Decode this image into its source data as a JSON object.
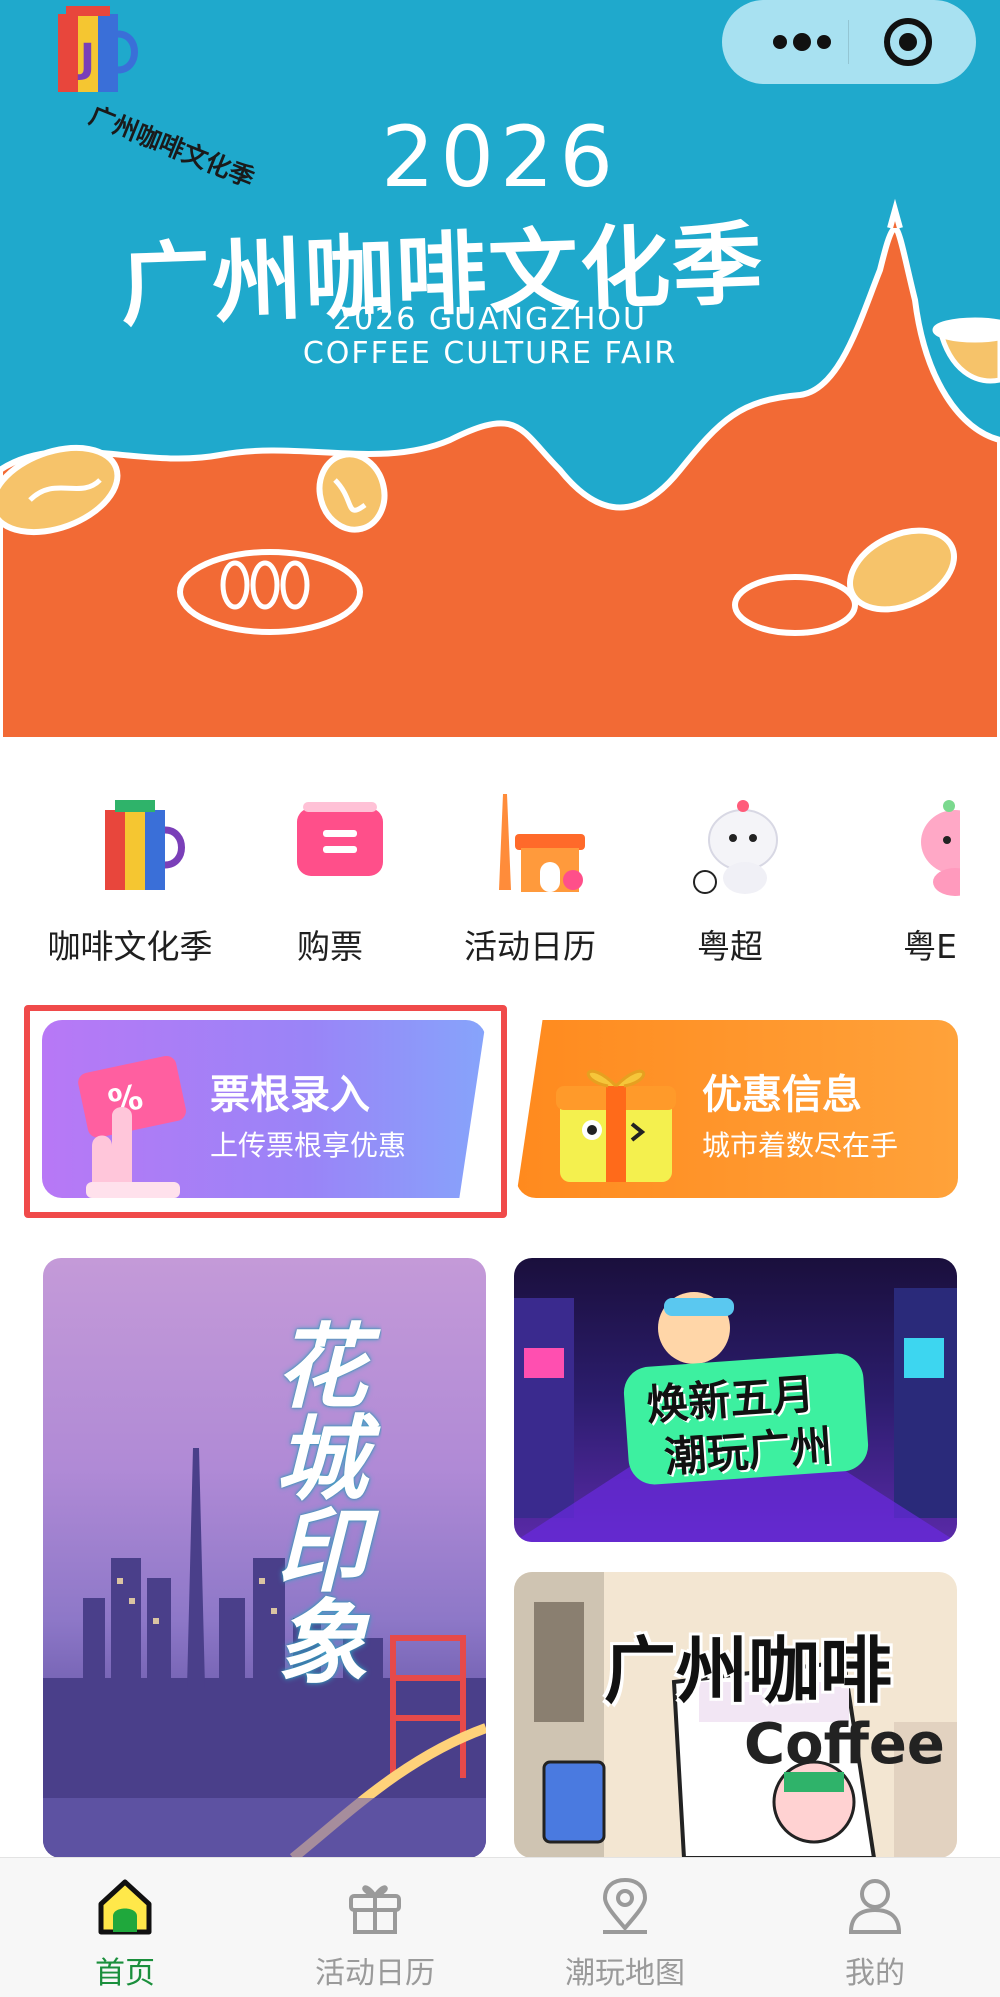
{
  "hero": {
    "year": "2026",
    "title": "广州咖啡文化季",
    "subtitle_en_line1": "2026 GUANGZHOU",
    "subtitle_en_line2": "COFFEE CULTURE FAIR",
    "logo_text": "广州咖啡文化季",
    "colors": {
      "sky": "#1fa9cc",
      "ground": "#f26a35",
      "bean": "#f6c36a"
    }
  },
  "capsule": {
    "more_icon": "more-dots-icon",
    "close_icon": "target-close-icon"
  },
  "quick_items": [
    {
      "label": "咖啡文化季",
      "icon": "coffee-cup-icon"
    },
    {
      "label": "购票",
      "icon": "ticket-icon"
    },
    {
      "label": "活动日历",
      "icon": "canton-tower-calendar-icon"
    },
    {
      "label": "粤超",
      "icon": "mascot-football-icon"
    },
    {
      "label": "粤E",
      "icon": "mascot-pink-icon"
    }
  ],
  "promos": {
    "ticket": {
      "title": "票根录入",
      "subtitle": "上传票根享优惠",
      "icon": "ticket-hand-icon",
      "colors": [
        "#b878f6",
        "#86a4fb"
      ]
    },
    "deal": {
      "title": "优惠信息",
      "subtitle": "城市着数尽在手",
      "icon": "gift-box-icon",
      "colors": [
        "#ff8a1e",
        "#ffa23a"
      ]
    },
    "highlight_color": "#f04a4a"
  },
  "tiles": {
    "huacheng": {
      "text": "花城印象"
    },
    "chaowan": {
      "line1": "焕新五月",
      "line2": "潮玩广州"
    },
    "coffee": {
      "title": "广州咖啡",
      "deco": "Coffee"
    }
  },
  "tabbar": {
    "active_color": "#1a8f3c",
    "tabs": [
      {
        "label": "首页",
        "icon": "home-icon",
        "active": true
      },
      {
        "label": "活动日历",
        "icon": "gift-icon",
        "active": false
      },
      {
        "label": "潮玩地图",
        "icon": "location-pin-icon",
        "active": false
      },
      {
        "label": "我的",
        "icon": "user-icon",
        "active": false
      }
    ]
  }
}
